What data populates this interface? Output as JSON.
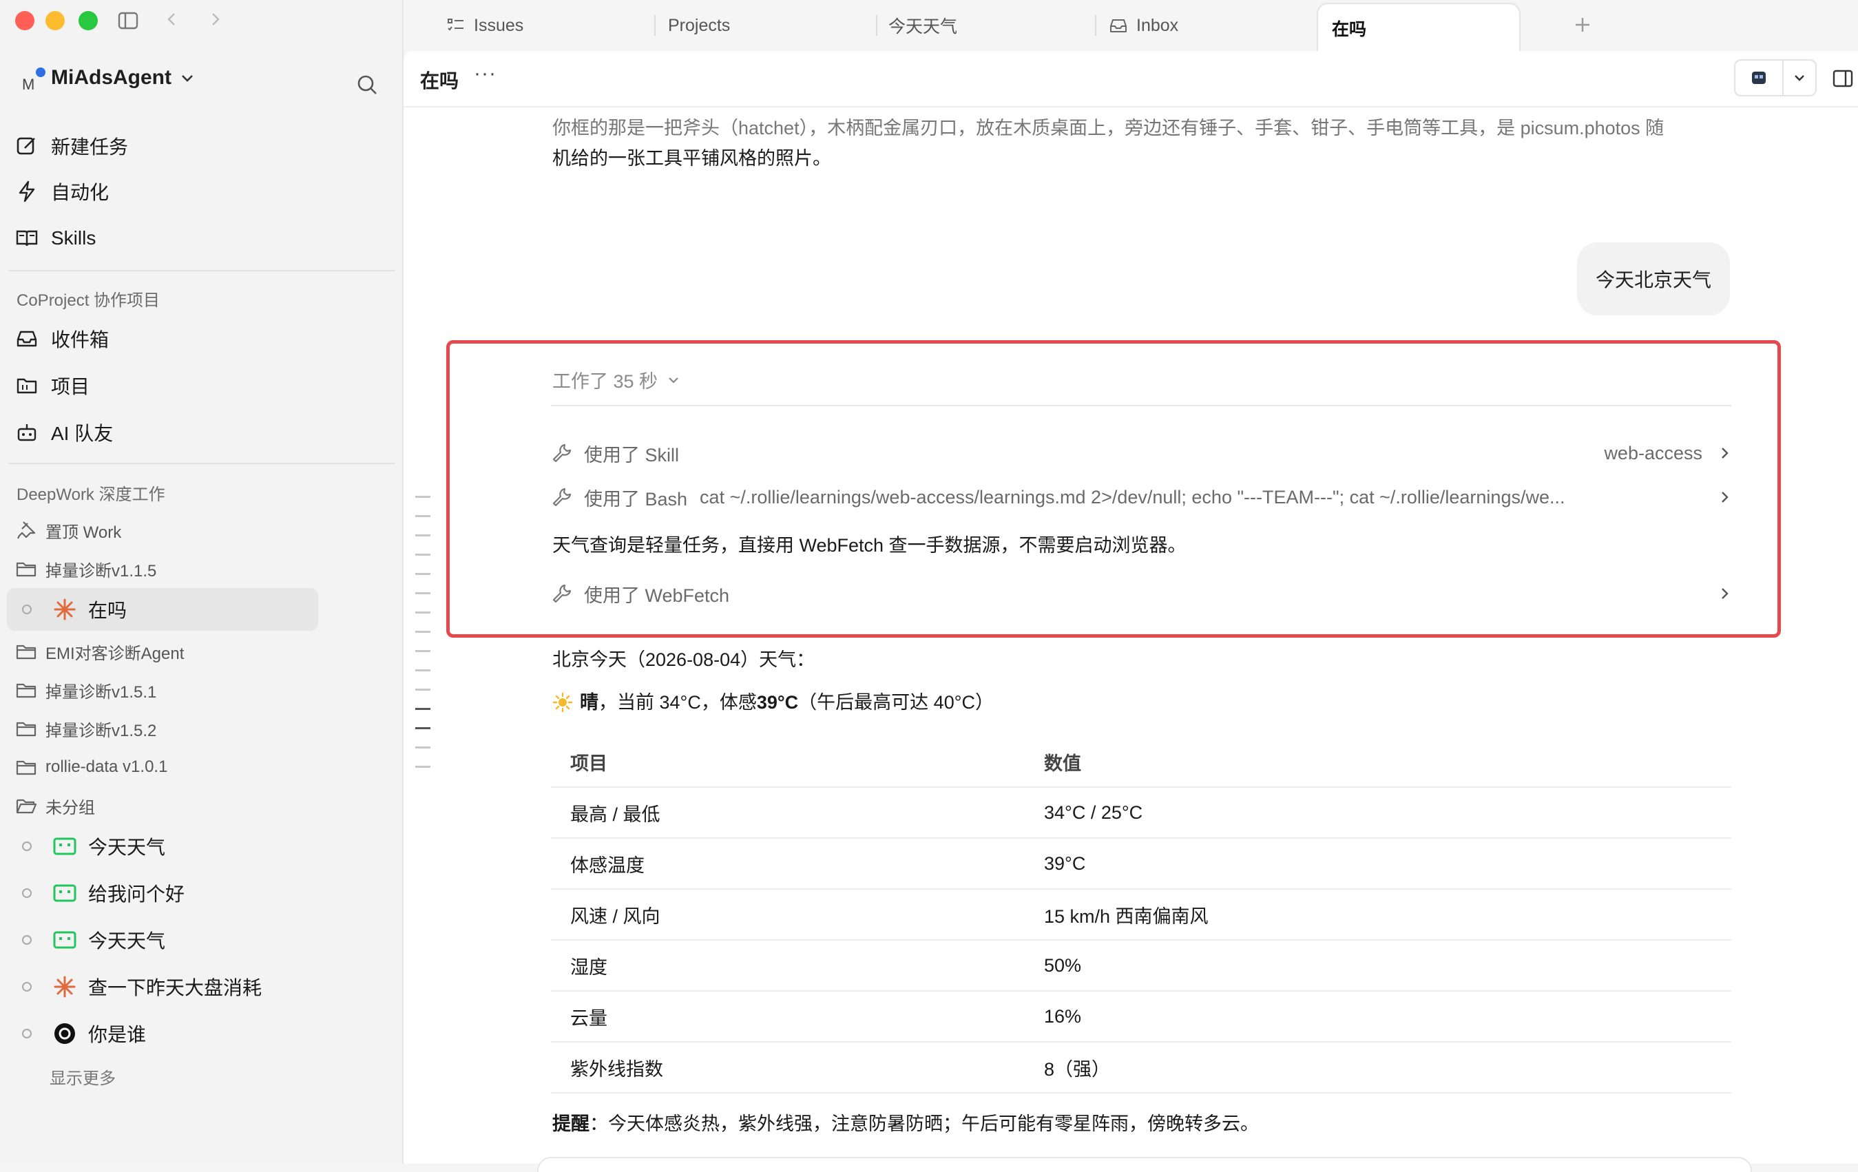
{
  "window": {
    "workspace_badge": "M",
    "workspace_name": "MiAdsAgent"
  },
  "sidebar": {
    "nav": [
      {
        "label": "新建任务",
        "icon": "edit-icon"
      },
      {
        "label": "自动化",
        "icon": "bolt-icon"
      },
      {
        "label": "Skills",
        "icon": "book-icon"
      }
    ],
    "coproject_title": "CoProject 协作项目",
    "coproject_items": [
      {
        "label": "收件箱",
        "icon": "inbox-icon"
      },
      {
        "label": "项目",
        "icon": "folder-icon"
      },
      {
        "label": "AI 队友",
        "icon": "robot-icon"
      }
    ],
    "deepwork_title": "DeepWork 深度工作",
    "pinned": "置顶 Work",
    "folder_1": "掉量诊断v1.1.5",
    "active_task": "在吗",
    "folders": [
      "EMI对客诊断Agent",
      "掉量诊断v1.5.1",
      "掉量诊断v1.5.2",
      "rollie-data v1.0.1",
      "未分组"
    ],
    "tasks": [
      {
        "label": "今天天气",
        "icon": "chat-bubble-icon"
      },
      {
        "label": "给我问个好",
        "icon": "chat-bubble-icon"
      },
      {
        "label": "今天天气",
        "icon": "chat-bubble-icon"
      },
      {
        "label": "查一下昨天大盘消耗",
        "icon": "sparkle-icon"
      },
      {
        "label": "你是谁",
        "icon": "openai-icon"
      }
    ],
    "show_more": "显示更多"
  },
  "tabs": [
    {
      "label": "Issues",
      "icon": "list-icon"
    },
    {
      "label": "Projects",
      "icon": ""
    },
    {
      "label": "今天天气",
      "icon": ""
    },
    {
      "label": "Inbox",
      "icon": "inbox-icon"
    },
    {
      "label": "在吗",
      "icon": "",
      "active": true
    }
  ],
  "header": {
    "title": "在吗",
    "more": "···"
  },
  "chat": {
    "prev_answer_line1": "你框的那是一把斧头（hatchet），木柄配金属刃口，放在木质桌面上，旁边还有锤子、手套、钳子、手电筒等工具，是 picsum.photos 随",
    "prev_answer_line2": "机给的一张工具平铺风格的照片。",
    "user_message": "今天北京天气",
    "worked_label": "工作了 35 秒",
    "tool_skill_label": "使用了 Skill",
    "tool_skill_value": "web-access",
    "tool_bash_label": "使用了 Bash",
    "tool_bash_cmd": "cat ~/.rollie/learnings/web-access/learnings.md 2>/dev/null; echo \"---TEAM---\"; cat ~/.rollie/learnings/we...",
    "reasoning": "天气查询是轻量任务，直接用 WebFetch 查一手数据源，不需要启动浏览器。",
    "tool_webfetch_label": "使用了 WebFetch",
    "weather_heading": "北京今天（2026-08-04）天气：",
    "weather_summary_bold1": "晴",
    "weather_summary_mid": "，当前 34°C，体感 ",
    "weather_summary_bold2": "39°C",
    "weather_summary_end": "（午后最高可达 40°C）",
    "table_headers": [
      "项目",
      "数值"
    ],
    "table_rows": [
      [
        "最高 / 最低",
        "34°C / 25°C"
      ],
      [
        "体感温度",
        "39°C"
      ],
      [
        "风速 / 风向",
        "15 km/h 西南偏南风"
      ],
      [
        "湿度",
        "50%"
      ],
      [
        "云量",
        "16%"
      ],
      [
        "紫外线指数",
        "8（强）"
      ]
    ],
    "reminder_label": "提醒",
    "reminder_text": "：今天体感炎热，紫外线强，注意防暑防晒；午后可能有零星阵雨，傍晚转多云。"
  },
  "colors": {
    "highlight_border": "#e5484d",
    "active_task_bg": "#e6e6e6",
    "accent_orange": "#e06a3b",
    "accent_green": "#22c55e"
  }
}
